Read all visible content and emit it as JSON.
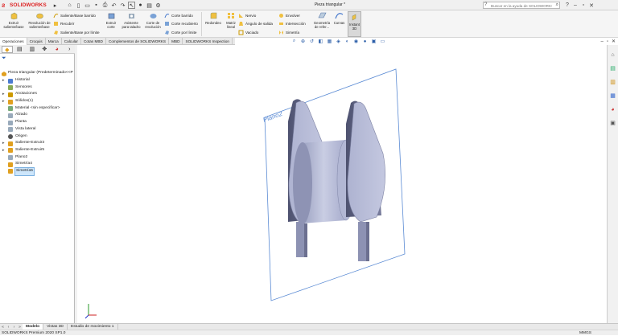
{
  "app": {
    "brand": "SOLIDWORKS",
    "document_title": "Pieza triangular *",
    "help_search_placeholder": "Buscar en la ayuda de SOLIDWORKS"
  },
  "ribbon": {
    "extruir_saliente": "Extruir saliente/base",
    "revolucion_saliente": "Revolución de saliente/base",
    "saliente_barrido": "Saliente/Base barrido",
    "recubrir": "Recubrir",
    "saliente_limite": "Saliente/Base por límite",
    "extruir_corte": "Extruir corte",
    "asistente_taladro": "Asistente para taladro",
    "corte_revolucion": "Corte de revolución",
    "corte_barrido": "Corte barrido",
    "corte_recubierto": "Corte recubierto",
    "corte_limite": "Corte por límite",
    "redondeo": "Redondeo",
    "matriz_lineal": "Matriz lineal",
    "nervio": "Nervio",
    "angulo_salida": "Ángulo de salida",
    "vaciado": "Vaciado",
    "envolver": "Envolver",
    "interseccion": "Intersección",
    "simetria": "Simetría",
    "geometria_ref": "Geometría de refer...",
    "curvas": "Curvas",
    "instant3d": "Instant 3D"
  },
  "tabs": [
    "Operaciones",
    "Croquis",
    "Marca",
    "Calcular",
    "Cotas MBD",
    "Complementos de SOLIDWORKS",
    "MBD",
    "SOLIDWORKS Inspection"
  ],
  "tree": {
    "root": "Pieza triangular  (Predeterminado<<P",
    "items": [
      {
        "label": "Historial",
        "expand": "▸",
        "icon": "history-icon"
      },
      {
        "label": "Sensores",
        "expand": "",
        "icon": "sensor-icon"
      },
      {
        "label": "Anotaciones",
        "expand": "▸",
        "icon": "annotation-icon"
      },
      {
        "label": "Sólidos(1)",
        "expand": "▸",
        "icon": "solid-bodies-icon"
      },
      {
        "label": "Material <sin especificar>",
        "expand": "",
        "icon": "material-icon"
      },
      {
        "label": "Alzado",
        "expand": "",
        "icon": "plane-icon"
      },
      {
        "label": "Planta",
        "expand": "",
        "icon": "plane-icon"
      },
      {
        "label": "Vista lateral",
        "expand": "",
        "icon": "plane-icon"
      },
      {
        "label": "Origen",
        "expand": "",
        "icon": "origin-icon"
      },
      {
        "label": "Saliente-Extruir3",
        "expand": "▸",
        "icon": "extrude-icon"
      },
      {
        "label": "Saliente-Extruir5",
        "expand": "▸",
        "icon": "extrude-icon"
      },
      {
        "label": "Plano2",
        "expand": "",
        "icon": "plane-icon"
      },
      {
        "label": "Simetría4",
        "expand": "",
        "icon": "mirror-icon"
      },
      {
        "label": "Simetría5",
        "expand": "",
        "icon": "mirror-icon"
      }
    ]
  },
  "viewport": {
    "plane_label": "Plano2"
  },
  "bottom_tabs": [
    "Modelo",
    "Vistas 3D",
    "Estudio de movimiento 1"
  ],
  "status": {
    "left": "SOLIDWORKS Premium 2020 SP1.0",
    "right": "MMGS"
  },
  "colors": {
    "brand_red": "#d22020",
    "model_fill": "#b9bdd6",
    "plane_blue": "#5b8bd4"
  }
}
